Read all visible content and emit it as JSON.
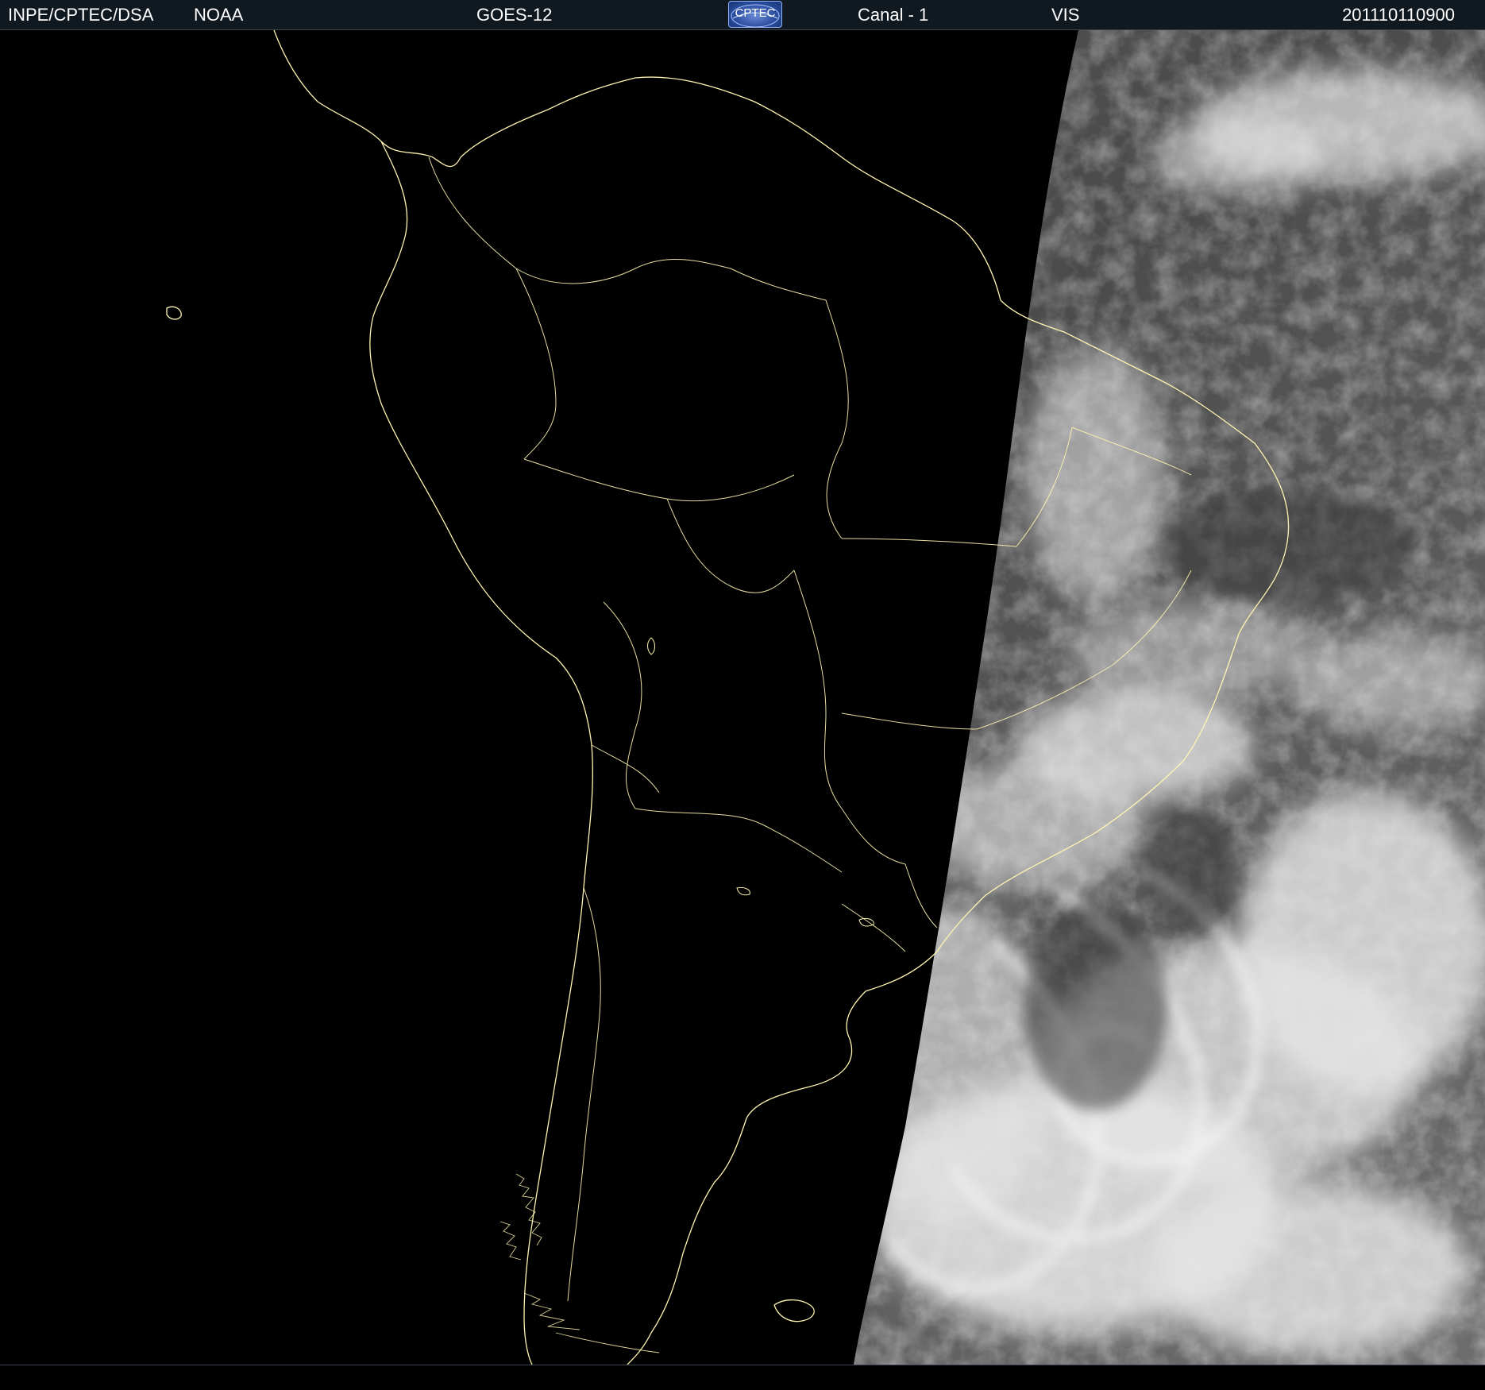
{
  "header": {
    "agency": "INPE/CPTEC/DSA",
    "source": "NOAA",
    "satellite": "GOES-12",
    "logo_text": "CPTEC",
    "channel": "Canal - 1",
    "band": "VIS",
    "timestamp": "201110110900"
  },
  "colors": {
    "header_background": "#101820",
    "header_text": "#ffffff",
    "coastline": "#fff4b0",
    "night_side": "#000000",
    "cloud_light": "#f2f2f2",
    "ocean_dark": "#4a4a4a"
  },
  "map": {
    "region": "South America",
    "view": "visible-channel satellite image with day/night terminator"
  }
}
